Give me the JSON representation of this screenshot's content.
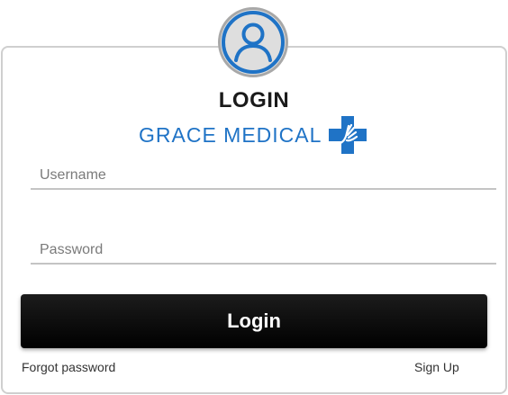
{
  "header": {
    "title": "LOGIN",
    "brand_name": "GRACE MEDICAL"
  },
  "icons": {
    "avatar": "user-icon",
    "brand_logo": "medical-cross-hand-icon"
  },
  "form": {
    "username_placeholder": "Username",
    "username_value": "",
    "password_placeholder": "Password",
    "password_value": ""
  },
  "actions": {
    "login_label": "Login",
    "forgot_password_label": "Forgot password",
    "sign_up_label": "Sign Up"
  },
  "colors": {
    "brand_blue": "#1f73c6",
    "button_bg": "#000000",
    "avatar_bg": "#dedede"
  }
}
